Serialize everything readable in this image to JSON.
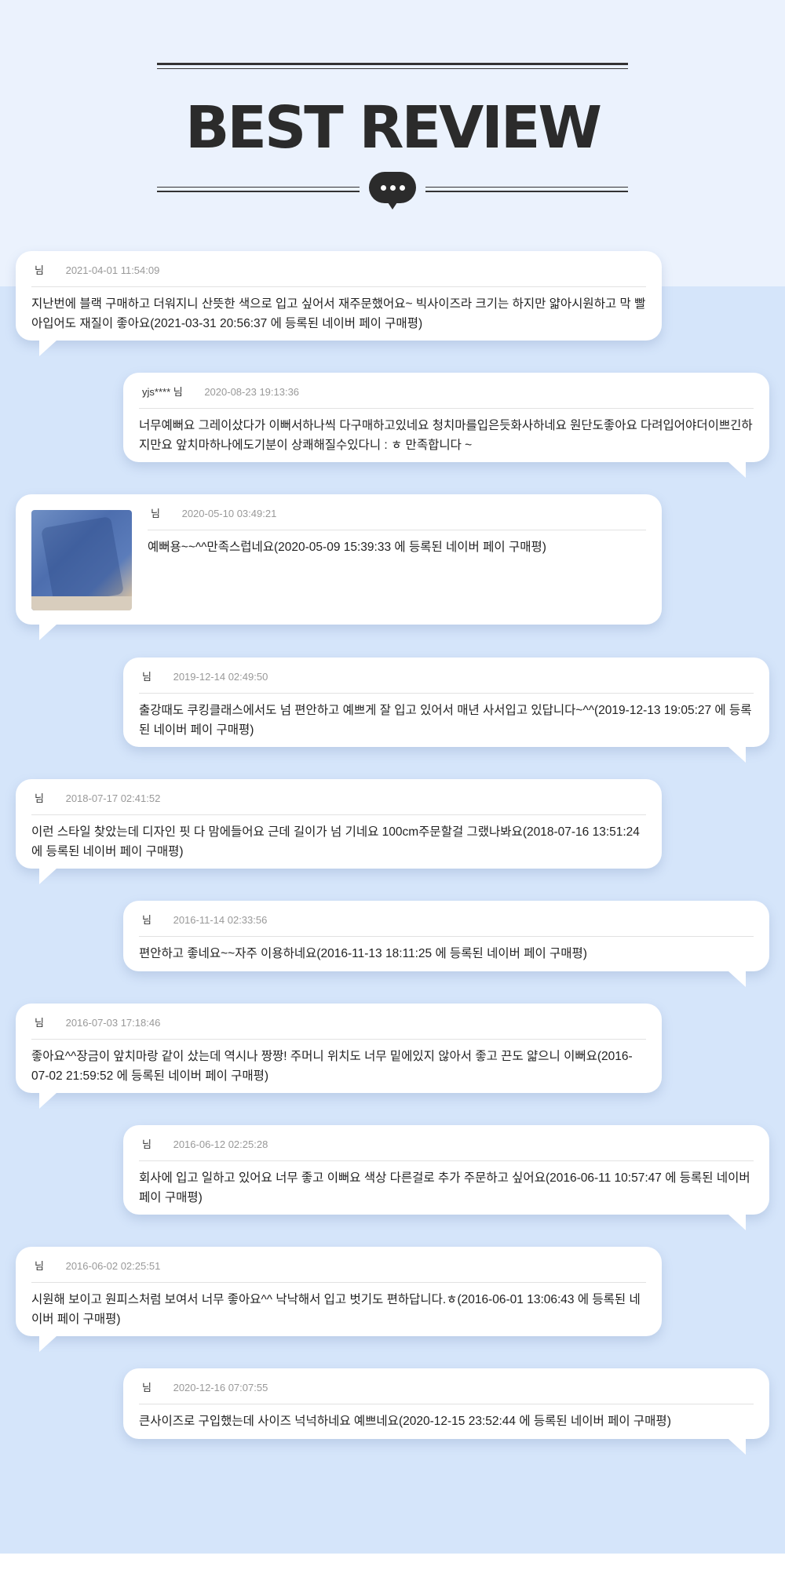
{
  "header": {
    "title": "BEST REVIEW"
  },
  "reviews": [
    {
      "author": "님",
      "date": "2021-04-01 11:54:09",
      "text": "지난번에 블랙 구매하고 더워지니 산뜻한 색으로 입고 싶어서 재주문했어요~ 빅사이즈라 크기는 하지만 얇아시원하고 막 빨아입어도 재질이 좋아요(2021-03-31 20:56:37 에 등록된 네이버 페이 구매평)"
    },
    {
      "author": "yjs**** 님",
      "date": "2020-08-23 19:13:36",
      "text": "너무예뻐요 그레이샀다가 이뻐서하나씩 다구매하고있네요 청치마를입은듯화사하네요 원단도좋아요 다려입어야더이쁘긴하지만요 앞치마하나에도기분이 상쾌해질수있다니 : ㅎ 만족합니다 ~"
    },
    {
      "author": "님",
      "date": "2020-05-10 03:49:21",
      "text": "예뻐용~~^^만족스럽네요(2020-05-09 15:39:33 에 등록된 네이버 페이 구매평)",
      "has_photo": true
    },
    {
      "author": "님",
      "date": "2019-12-14 02:49:50",
      "text": "출강때도 쿠킹클래스에서도 넘 편안하고 예쁘게 잘 입고 있어서 매년 사서입고 있답니다~^^(2019-12-13 19:05:27 에 등록된 네이버 페이 구매평)"
    },
    {
      "author": "님",
      "date": "2018-07-17 02:41:52",
      "text": "이런 스타일 찾았는데 디자인 핏 다 맘에들어요 근데 길이가 넘 기네요 100cm주문할걸 그랬나봐요(2018-07-16 13:51:24 에 등록된 네이버 페이 구매평)"
    },
    {
      "author": "님",
      "date": "2016-11-14 02:33:56",
      "text": "편안하고 좋네요~~자주 이용하네요(2016-11-13 18:11:25 에 등록된 네이버 페이 구매평)"
    },
    {
      "author": "님",
      "date": "2016-07-03 17:18:46",
      "text": "좋아요^^장금이 앞치마랑 같이 샀는데 역시나 짱짱! 주머니 위치도 너무 밑에있지 않아서 좋고 끈도 얇으니 이뻐요(2016-07-02 21:59:52 에 등록된 네이버 페이 구매평)"
    },
    {
      "author": "님",
      "date": "2016-06-12 02:25:28",
      "text": "회사에 입고 일하고 있어요 너무 좋고 이뻐요 색상 다른걸로 추가 주문하고 싶어요(2016-06-11 10:57:47 에 등록된 네이버 페이 구매평)"
    },
    {
      "author": "님",
      "date": "2016-06-02 02:25:51",
      "text": "시원해 보이고 원피스처럼 보여서 너무 좋아요^^ 낙낙해서 입고 벗기도 편하답니다.ㅎ(2016-06-01 13:06:43 에 등록된 네이버 페이 구매평)"
    },
    {
      "author": "님",
      "date": "2020-12-16 07:07:55",
      "text": "큰사이즈로 구입했는데 사이즈 넉넉하네요 예쁘네요(2020-12-15 23:52:44 에 등록된 네이버 페이 구매평)"
    }
  ]
}
